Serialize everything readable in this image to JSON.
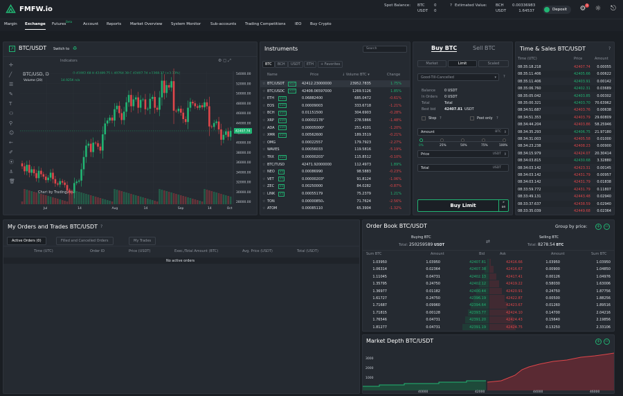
{
  "header": {
    "brand": "FMFW.io",
    "spot_balance_label": "Spot Balance:",
    "spot_currencies": [
      "BTC",
      "USDT"
    ],
    "spot_values": [
      "0",
      "0"
    ],
    "est_label": "Estimated Value:",
    "est_currencies": [
      "BCH",
      "USDT"
    ],
    "est_values": [
      "0.00336983",
      "1.64537"
    ],
    "deposit": "Deposit",
    "notif_count": "1"
  },
  "nav": {
    "items": [
      "Margin",
      "Exchange",
      "Futures",
      "Account",
      "Reports",
      "Market Overview",
      "System Monitor",
      "Sub-accounts",
      "Trading Competitions",
      "IEO",
      "Buy Crypto"
    ],
    "beta": "Beta",
    "active": "Exchange"
  },
  "chart": {
    "pair": "BTC/USDT",
    "switch_to": "Switch to",
    "indicators": "Indicators",
    "symbol_line": "BTC/USD, D",
    "ohlc": "O 41002.68 H 42489.75 L 40764.38 C 42407.74 +1368.37 (+3.33%)",
    "volume": "Volume (20)",
    "vol_val": "14.925K n/a",
    "tv": "Chart by TradingView",
    "last_price": "42407.74",
    "colors": {
      "up": "#21b573",
      "down": "#e0464a"
    }
  },
  "chart_data": {
    "type": "candlestick",
    "x_ticks": [
      "Jul",
      "14",
      "Aug",
      "14",
      "Sep",
      "14",
      "Oct"
    ],
    "y_ticks": [
      "54000.00",
      "52000.00",
      "50000.00",
      "48000.00",
      "46000.00",
      "44000.00",
      "42000.00",
      "40000.00",
      "38000.00",
      "36000.00",
      "34000.00",
      "32000.00",
      "30000.00",
      "28000.00"
    ],
    "ylim": [
      27500,
      54500
    ],
    "closes": [
      35200,
      34200,
      35500,
      33900,
      34600,
      33800,
      32800,
      34300,
      33600,
      33100,
      32400,
      32900,
      33900,
      32600,
      31700,
      31500,
      32200,
      31900,
      31400,
      30300,
      29900,
      29800,
      31800,
      32100,
      32300,
      34600,
      37100,
      39400,
      39800,
      38100,
      40000,
      39900,
      39200,
      38400,
      41700,
      43900,
      44500,
      45100,
      44500,
      46800,
      47500,
      46000,
      44600,
      46300,
      48200,
      49700,
      47400,
      48800,
      49200,
      47100,
      48700,
      48800,
      46800,
      46900,
      48900,
      49300,
      47100,
      46700,
      49200,
      52600,
      50100,
      51700,
      51200,
      52500,
      46500,
      46400,
      46900,
      46100,
      44800,
      44200,
      47100,
      48300,
      48000,
      47400,
      47100,
      47600,
      47200,
      48200,
      47400,
      43300,
      43200,
      44000,
      44300,
      42700,
      40600,
      41600,
      42300,
      41200,
      42400
    ]
  },
  "instruments": {
    "title": "Instruments",
    "search": "Search",
    "tabs": [
      "BTC",
      "BCH",
      "USDT",
      "ETH",
      "+ Favorites"
    ],
    "cols": [
      "Name",
      "Price",
      "Volume BTC",
      "Change"
    ],
    "rows": [
      {
        "name": "BTC/USDT",
        "lev": "x12",
        "price": "42412.23000000",
        "vol": "23952.7835",
        "chg": "1.75%",
        "up": true
      },
      {
        "name": "BTC/USDC",
        "lev": "x10",
        "price": "42408.06597000",
        "vol": "1269.5126",
        "chg": "1.85%",
        "up": true
      },
      {
        "name": "ETH",
        "lev": "x10",
        "price": "0.06882400",
        "vol": "685.0472",
        "chg": "-0.61%",
        "up": false
      },
      {
        "name": "EOS",
        "lev": "x10",
        "price": "0.00009003",
        "vol": "333.6718",
        "chg": "-1.21%",
        "up": false
      },
      {
        "name": "BCH",
        "lev": "x10",
        "price": "0.01151500",
        "vol": "304.6903",
        "chg": "-0.28%",
        "up": false
      },
      {
        "name": "XRP",
        "lev": "x10",
        "price": "0.00002178⁷",
        "vol": "278.5866",
        "chg": "-1.48%",
        "up": false
      },
      {
        "name": "ADA",
        "lev": "x10",
        "price": "0.00005000⁴",
        "vol": "251.4101",
        "chg": "-1.20%",
        "up": false
      },
      {
        "name": "XMR",
        "lev": "x10",
        "price": "0.00562600",
        "vol": "189.3519",
        "chg": "-0.21%",
        "up": false
      },
      {
        "name": "OMG",
        "lev": "",
        "price": "0.00022557",
        "vol": "179.7923",
        "chg": "-2.27%",
        "up": false
      },
      {
        "name": "WAVES",
        "lev": "",
        "price": "0.00056033",
        "vol": "119.5816",
        "chg": "-5.19%",
        "up": false
      },
      {
        "name": "TRX",
        "lev": "x10",
        "price": "0.00000203⁷",
        "vol": "115.8512",
        "chg": "-0.10%",
        "up": false
      },
      {
        "name": "BTC/TUSD",
        "lev": "",
        "price": "42471.92000000",
        "vol": "112.4973",
        "chg": "1.89%",
        "up": true
      },
      {
        "name": "NEO",
        "lev": "x5",
        "price": "0.00086990",
        "vol": "98.5883",
        "chg": "-0.23%",
        "up": false
      },
      {
        "name": "VET",
        "lev": "x5",
        "price": "0.00000203⁶",
        "vol": "91.8124",
        "chg": "-1.06%",
        "up": false
      },
      {
        "name": "ZEC",
        "lev": "x5",
        "price": "0.00250000",
        "vol": "84.0282",
        "chg": "-0.87%",
        "up": false
      },
      {
        "name": "LINK",
        "lev": "x5",
        "price": "0.00055179",
        "vol": "75.2379",
        "chg": "1.21%",
        "up": true
      },
      {
        "name": "TON",
        "lev": "",
        "price": "0.00000850₁",
        "vol": "71.7624",
        "chg": "-2.56%",
        "up": false
      },
      {
        "name": "ATOM",
        "lev": "",
        "price": "0.00085110",
        "vol": "65.3904",
        "chg": "-1.32%",
        "up": false
      }
    ]
  },
  "order_form": {
    "buy": "Buy BTC",
    "sell": "Sell BTC",
    "tabs": [
      "Market",
      "Limit",
      "Scaled"
    ],
    "tif": "Good-Till-Cancelled",
    "balance_lbl": "Balance",
    "balance": "0 USDT",
    "in_orders_lbl": "In Orders",
    "in_orders": "0 USDT",
    "total_lbl": "Total",
    "total": "Total",
    "best_bid_lbl": "Best bid",
    "best_bid": "42407.81",
    "best_bid_cur": "USDT",
    "stop": "Stop",
    "post_only": "Post only",
    "amount": "Amount",
    "amount_cur": "BTC",
    "pct": [
      "0%",
      "25%",
      "50%",
      "75%",
      "100%"
    ],
    "price": "Price",
    "price_cur": "USDT",
    "total_cur": "USDT",
    "buy_limit": "Buy Limit",
    "on": "on"
  },
  "time_sales": {
    "title": "Time & Sales BTC/USDT",
    "cols": [
      "Time (UTC)",
      "Price",
      "Amount"
    ],
    "rows": [
      [
        "08:35:18.218",
        "42407.74",
        "0.00055",
        false
      ],
      [
        "08:35:11.406",
        "42405.66",
        "0.00622",
        true
      ],
      [
        "08:35:11.406",
        "42403.91",
        "0.00142",
        true
      ],
      [
        "08:35:06.760",
        "42402.31",
        "0.03689",
        true
      ],
      [
        "08:35:05.042",
        "42403.85",
        "0.00302",
        true
      ],
      [
        "08:35:00.321",
        "42403.70",
        "70.63962",
        true
      ],
      [
        "08:34:51.687",
        "42403.76",
        "0.00638",
        false
      ],
      [
        "08:34:51.353",
        "42403.79",
        "29.60809",
        false
      ],
      [
        "08:34:44.204",
        "42403.86",
        "58.25946",
        false
      ],
      [
        "08:34:35.293",
        "42406.75",
        "21.97180",
        true
      ],
      [
        "08:34:31.003",
        "42405.58",
        "0.01000",
        false
      ],
      [
        "08:34:23.238",
        "42408.23",
        "0.00900",
        false
      ],
      [
        "08:34:15.979",
        "42424.07",
        "20.30414",
        false
      ],
      [
        "08:34:03.815",
        "42430.68",
        "3.32880",
        true
      ],
      [
        "08:34:03.142",
        "42423.31",
        "0.00145",
        false
      ],
      [
        "08:34:03.142",
        "42431.79",
        "0.00957",
        false
      ],
      [
        "08:34:03.142",
        "42431.79",
        "0.01838",
        false
      ],
      [
        "08:33:59.772",
        "42431.79",
        "0.11807",
        false
      ],
      [
        "08:33:49.131",
        "42443.48",
        "0.02940",
        false
      ],
      [
        "08:33:37.637",
        "42438.59",
        "0.02940",
        false
      ],
      [
        "08:33:35.039",
        "42449.68",
        "0.02364",
        false
      ]
    ]
  },
  "my_orders": {
    "title": "My Orders and Trades BTC/USDT",
    "tabs": [
      "Active Orders (0)",
      "Filled and Cancelled Orders",
      "My Trades"
    ],
    "cols": [
      "Time (UTC)",
      "Order ID",
      "Price (USDT)",
      "Exec./Total Amount (BTC)",
      "Avg. Price (USDT)",
      "Total (USDT)"
    ],
    "empty": "No active orders"
  },
  "order_book": {
    "title": "Order Book BTC/USDT",
    "group": "Group by price:",
    "buying": "Buying BTC",
    "buy_total_lbl": "Total:",
    "buy_total": "250259589",
    "buy_cur": "USDT",
    "selling": "Selling BTC",
    "sell_total_lbl": "Total:",
    "sell_total": "8278.54",
    "sell_cur": "BTC",
    "cols": [
      "Sum BTC",
      "Amount",
      "Bid",
      "Ask",
      "Amount",
      "Sum BTC"
    ],
    "rows": [
      [
        "1.03950",
        "1.03950",
        "42407.81",
        "42416.66",
        "1.03950",
        "1.03950"
      ],
      [
        "1.06314",
        "0.02364",
        "42407.38",
        "42416.67",
        "0.00900",
        "1.04850"
      ],
      [
        "1.11045",
        "0.04731",
        "42402.13",
        "42417.41",
        "0.00126",
        "1.04976"
      ],
      [
        "1.35795",
        "0.24750",
        "42402.12",
        "42419.22",
        "0.58030",
        "1.63006"
      ],
      [
        "1.36977",
        "0.01182",
        "42400.44",
        "42420.91",
        "0.24750",
        "1.87756"
      ],
      [
        "1.61727",
        "0.24750",
        "42396.19",
        "42422.87",
        "0.00500",
        "1.88256"
      ],
      [
        "1.71687",
        "0.09960",
        "42394.64",
        "42423.67",
        "0.01260",
        "1.89516"
      ],
      [
        "1.71815",
        "0.00128",
        "42393.77",
        "42424.10",
        "0.14700",
        "2.04216"
      ],
      [
        "1.76546",
        "0.04731",
        "42391.20",
        "42424.43",
        "0.15640",
        "2.19856"
      ],
      [
        "1.81277",
        "0.04731",
        "42391.19",
        "42424.75",
        "0.13250",
        "2.33106"
      ]
    ]
  },
  "depth": {
    "title": "Market Depth BTC/USDT",
    "y_ticks": [
      "3000",
      "2000",
      "1000"
    ],
    "x_ticks": [
      "40000",
      "42000",
      "44000",
      "46000"
    ]
  }
}
